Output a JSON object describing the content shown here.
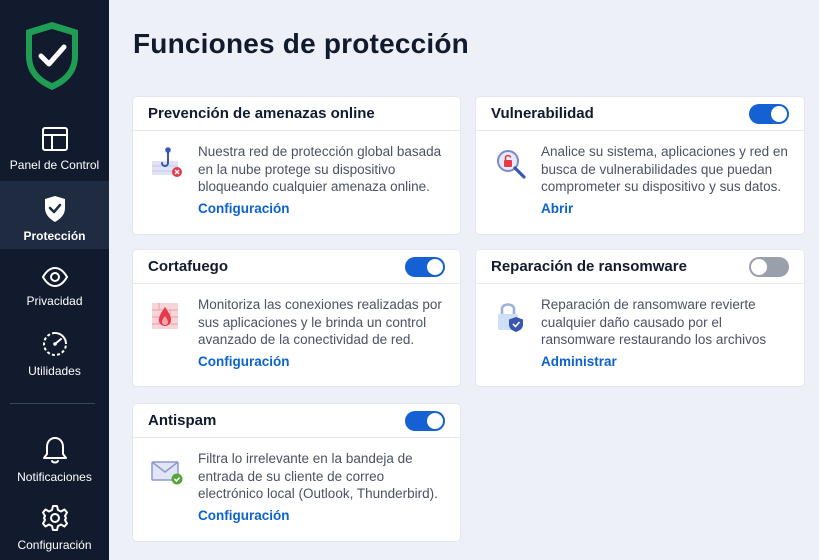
{
  "sidebar": {
    "items": [
      {
        "label": "Panel de Control",
        "icon": "dashboard-icon"
      },
      {
        "label": "Protección",
        "icon": "shield-icon",
        "active": true
      },
      {
        "label": "Privacidad",
        "icon": "eye-icon"
      },
      {
        "label": "Utilidades",
        "icon": "gauge-icon"
      },
      {
        "label": "Notificaciones",
        "icon": "bell-icon"
      },
      {
        "label": "Configuración",
        "icon": "gear-icon"
      }
    ]
  },
  "main": {
    "title": "Funciones de protección",
    "cards": [
      {
        "title": "Prevención de amenazas online",
        "icon": "phishing-hook-icon",
        "description": "Nuestra red de protección global basada en la nube protege su dispositivo bloqueando cualquier amenaza online.",
        "link": "Configuración"
      },
      {
        "title": "Vulnerabilidad",
        "icon": "vulnerability-scan-icon",
        "toggle": true,
        "description": "Analice su sistema, aplicaciones y red en busca de vulnerabilidades que puedan comprometer su dispositivo y sus datos.",
        "link": "Abrir"
      },
      {
        "title": "Cortafuego",
        "icon": "firewall-icon",
        "toggle": true,
        "description": "Monitoriza las conexiones realizadas por sus aplicaciones y le brinda un control avanzado de la conectividad de red.",
        "link": "Configuración"
      },
      {
        "title": "Reparación de ransomware",
        "icon": "ransomware-lock-icon",
        "toggle": false,
        "description": "Reparación de ransomware revierte cualquier daño causado por el ransomware restaurando los archivos",
        "link": "Administrar"
      },
      {
        "title": "Antispam",
        "icon": "antispam-mail-icon",
        "toggle": true,
        "description": "Filtra lo irrelevante en la bandeja de entrada de su cliente de correo electrónico local (Outlook, Thunderbird).",
        "link": "Configuración"
      }
    ]
  },
  "colors": {
    "sidebar_bg": "#111b2d",
    "accent": "#1560d3",
    "link": "#0c63ce",
    "brand_green": "#1f9d55"
  }
}
